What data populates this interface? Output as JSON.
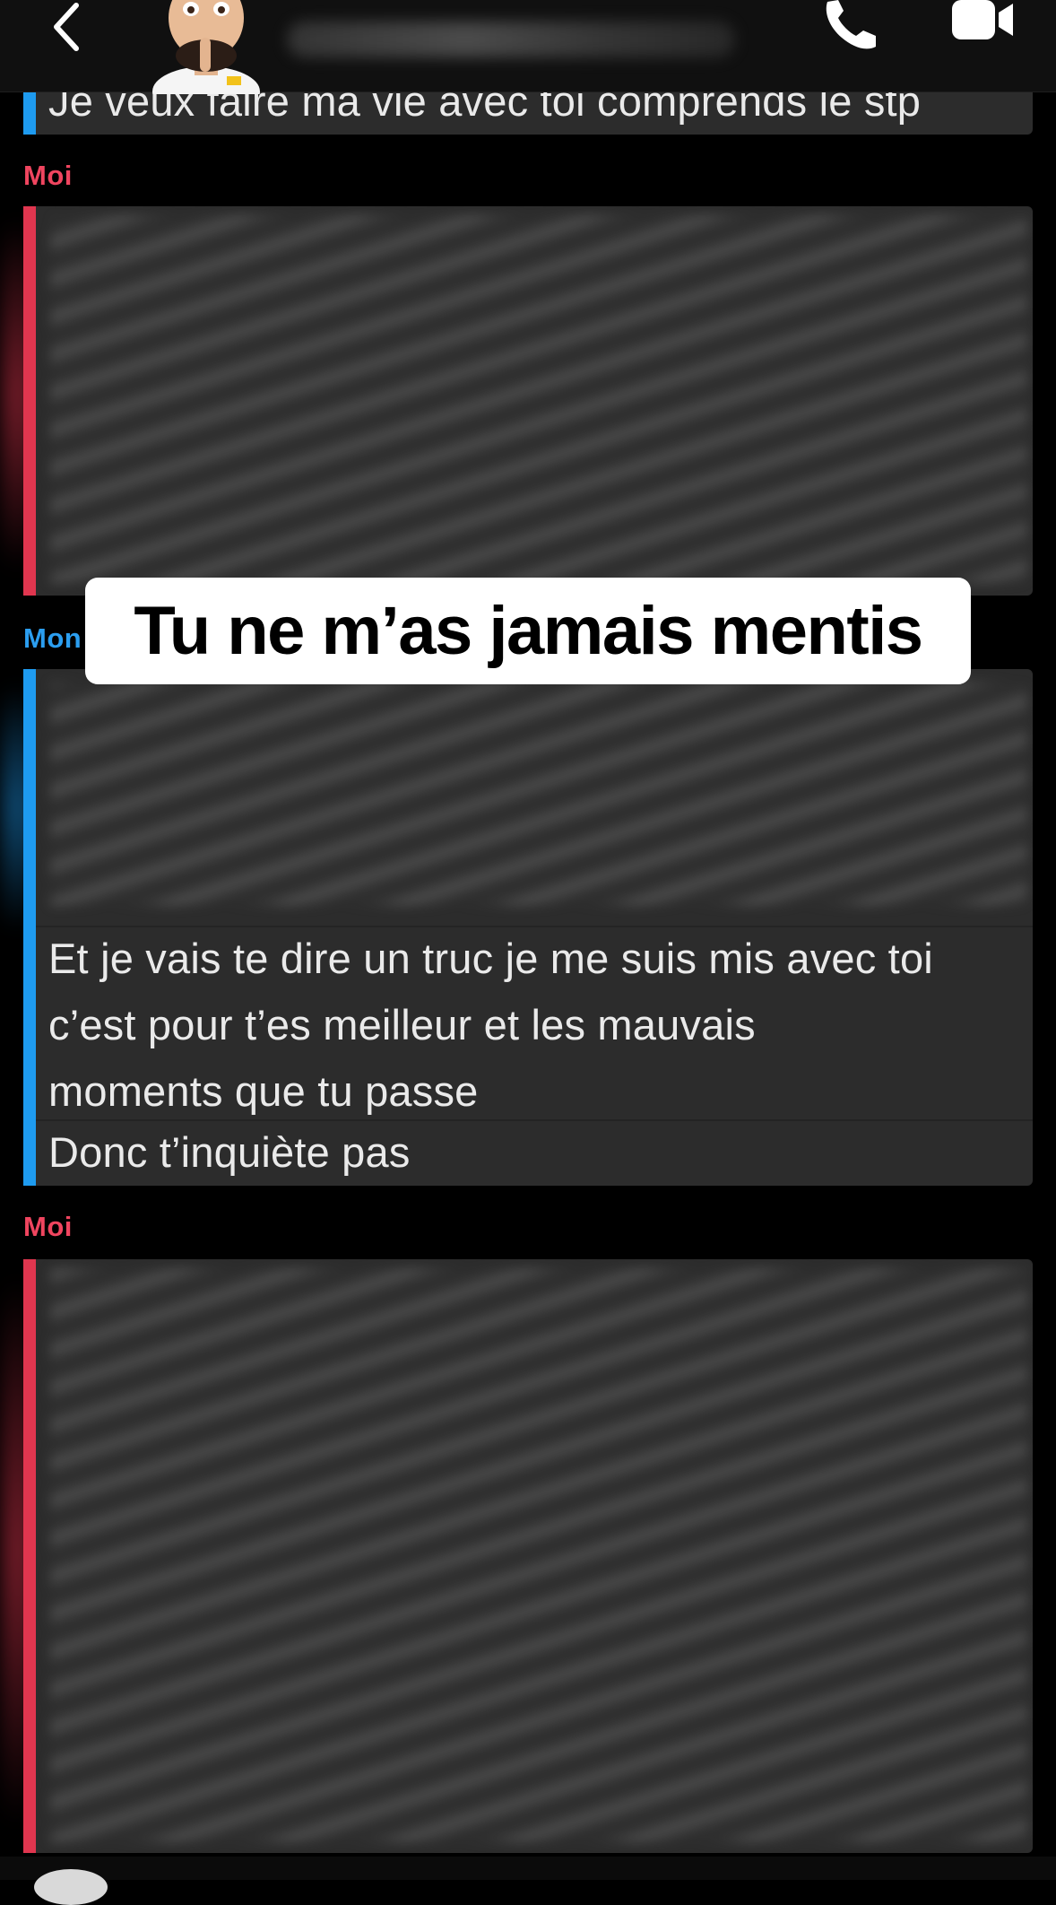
{
  "header": {
    "back_icon": "chevron-left-icon",
    "call_icon": "phone-icon",
    "video_icon": "video-camera-icon"
  },
  "messages": {
    "top_partial_text": "Je veux faire ma vie avec toi comprends le stp",
    "sender_me_1": "Moi",
    "sender_other": "Mon",
    "visible_lines": [
      "Et je vais te dire un truc je me suis mis avec toi",
      "c’est pour t’es meilleur et les mauvais",
      "moments que tu passe",
      "Donc t’inquiète pas"
    ],
    "sender_me_2": "Moi"
  },
  "caption": {
    "text": "Tu ne m’as jamais mentis"
  },
  "colors": {
    "me": "#e0364f",
    "other": "#1e9bf0",
    "bubble": "#2c2c2c",
    "background": "#000000"
  }
}
